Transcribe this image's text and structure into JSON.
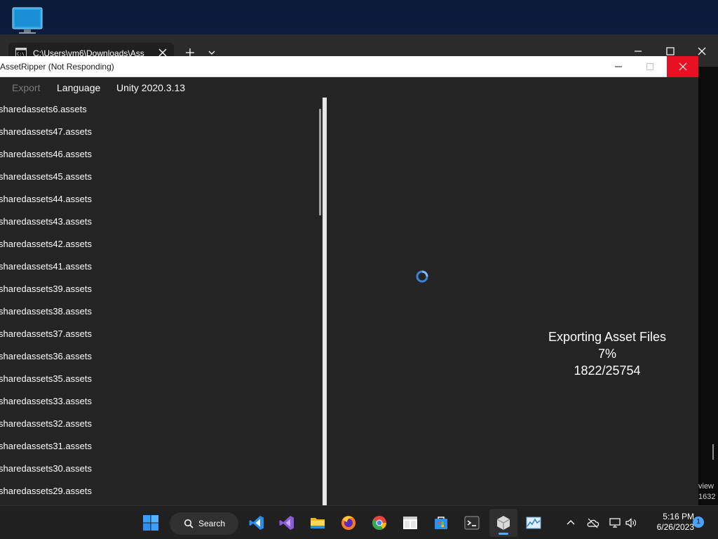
{
  "desktop": {
    "icon_name": "this-pc-icon"
  },
  "terminal": {
    "tab_title": "C:\\Users\\vm6\\Downloads\\Ass",
    "side_text_1": "view",
    "side_text_2": "1632"
  },
  "app": {
    "title": "AssetRipper (Not Responding)",
    "menu": {
      "export": "Export",
      "language": "Language",
      "version": "Unity 2020.3.13"
    },
    "files": [
      "sharedassets6.assets",
      "sharedassets47.assets",
      "sharedassets46.assets",
      "sharedassets45.assets",
      "sharedassets44.assets",
      "sharedassets43.assets",
      "sharedassets42.assets",
      "sharedassets41.assets",
      "sharedassets39.assets",
      "sharedassets38.assets",
      "sharedassets37.assets",
      "sharedassets36.assets",
      "sharedassets35.assets",
      "sharedassets33.assets",
      "sharedassets32.assets",
      "sharedassets31.assets",
      "sharedassets30.assets",
      "sharedassets29.assets"
    ],
    "progress": {
      "status": "Exporting Asset Files",
      "percent": "7%",
      "count": "1822/25754"
    }
  },
  "taskbar": {
    "search_label": "Search",
    "time": "5:16 PM",
    "date": "6/26/2023",
    "notification_count": "1",
    "accent_color": "#5aa7ff"
  }
}
